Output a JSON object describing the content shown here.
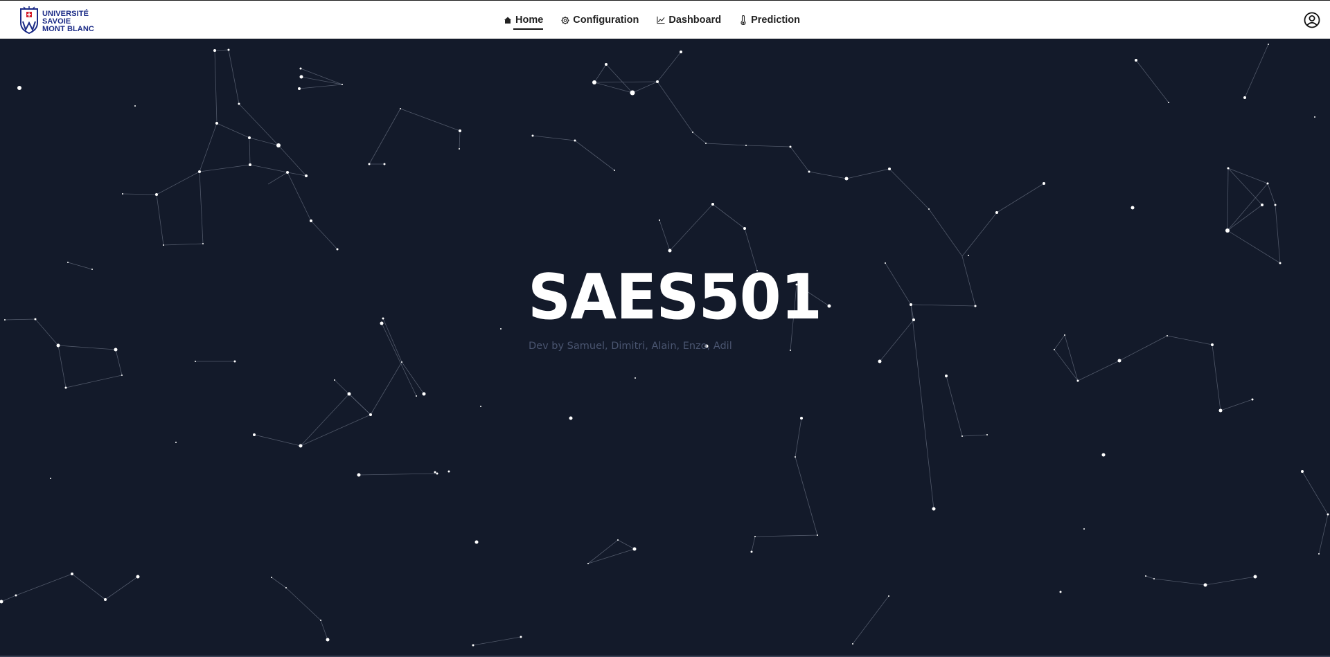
{
  "brand": {
    "logo_lines": [
      "UNIVERSITÉ",
      "SAVOIE",
      "MONT BLANC"
    ],
    "icon": "university-crest-icon",
    "color": "#1a2a86"
  },
  "nav": {
    "items": [
      {
        "label": "Home",
        "icon": "home-icon",
        "active": true
      },
      {
        "label": "Configuration",
        "icon": "gear-icon",
        "active": false
      },
      {
        "label": "Dashboard",
        "icon": "line-chart-icon",
        "active": false
      },
      {
        "label": "Prediction",
        "icon": "thermometer-icon",
        "active": false
      }
    ]
  },
  "user": {
    "icon": "user-circle-icon"
  },
  "hero": {
    "title": "SAES501",
    "subtitle": "Dev by Samuel, Dimitri, Alain, Enzo, Adil"
  },
  "theme": {
    "background": "#131a2a",
    "star_color": "#ffffff",
    "line_color": "#6b7384"
  }
}
